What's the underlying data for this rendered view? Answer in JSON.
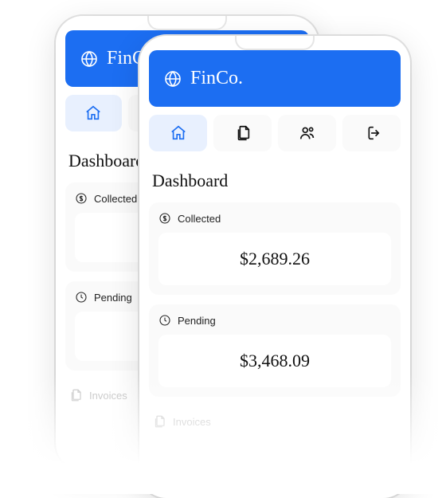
{
  "app": {
    "name": "FinCo."
  },
  "nav": {
    "items": [
      {
        "id": "home",
        "active": true
      },
      {
        "id": "documents",
        "active": false
      },
      {
        "id": "people",
        "active": false
      },
      {
        "id": "logout",
        "active": false
      }
    ]
  },
  "page": {
    "title": "Dashboard"
  },
  "cards": {
    "collected": {
      "label": "Collected",
      "value": "$2,689.26"
    },
    "pending": {
      "label": "Pending",
      "value": "$3,468.09"
    }
  },
  "invoices": {
    "label": "Invoices"
  },
  "colors": {
    "accent": "#1c6ef2"
  }
}
